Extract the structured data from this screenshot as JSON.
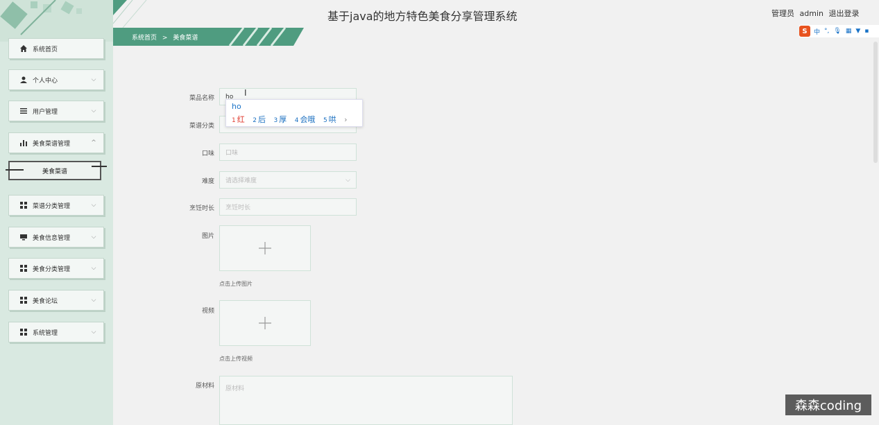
{
  "header": {
    "title": "基于java的地方特色美食分享管理系统",
    "role": "管理员",
    "username": "admin",
    "logout": "退出登录"
  },
  "breadcrumb": {
    "home": "系统首页",
    "separator": ">",
    "current": "美食菜谱"
  },
  "sidebar": {
    "items": [
      {
        "label": "系统首页",
        "icon": "home-icon"
      },
      {
        "label": "个人中心",
        "icon": "person-icon"
      },
      {
        "label": "用户管理",
        "icon": "list-icon"
      },
      {
        "label": "美食菜谱管理",
        "icon": "bar-chart-icon"
      },
      {
        "label": "菜谱分类管理",
        "icon": "grid-icon"
      },
      {
        "label": "美食信息管理",
        "icon": "monitor-icon"
      },
      {
        "label": "美食分类管理",
        "icon": "grid-icon"
      },
      {
        "label": "美食论坛",
        "icon": "grid-icon"
      },
      {
        "label": "系统管理",
        "icon": "grid-icon"
      }
    ],
    "sub_item": "美食菜谱"
  },
  "form": {
    "name_label": "菜品名称",
    "name_value": "ho",
    "category_label": "菜谱分类",
    "taste_label": "口味",
    "taste_placeholder": "口味",
    "difficulty_label": "难度",
    "difficulty_placeholder": "请选择难度",
    "duration_label": "烹饪时长",
    "duration_placeholder": "烹饪时长",
    "image_label": "图片",
    "image_hint": "点击上传图片",
    "video_label": "视频",
    "video_hint": "点击上传视频",
    "ingredients_label": "原材料",
    "ingredients_placeholder": "原材料"
  },
  "ime": {
    "typed": "ho",
    "candidates": [
      {
        "num": "1",
        "text": "红"
      },
      {
        "num": "2",
        "text": "后"
      },
      {
        "num": "3",
        "text": "厚"
      },
      {
        "num": "4",
        "text": "会哦"
      },
      {
        "num": "5",
        "text": "哄"
      }
    ],
    "next": "›",
    "toolbar_lang": "中",
    "toolbar_punct": "°,"
  },
  "watermark": "森森coding",
  "colors": {
    "accent": "#4f9c80",
    "sidebar_bg": "#d9e9e1"
  }
}
